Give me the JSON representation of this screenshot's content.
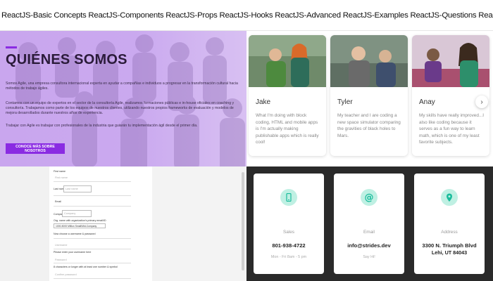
{
  "marquee": {
    "text": "ReactJS-Basic Concepts ReactJS-Components ReactJS-Props ReactJS-Hooks ReactJS-Advanced ReactJS-Examples ReactJS-Questions ReactJS-Quiz ReactJS-Tutorial Web Development Web Techno"
  },
  "about": {
    "title": "QUIÉNES SOMOS",
    "p1": "Somos Agile, una empresa consultora internacional experta en ayudar a compañías e individuos a progresar en la transformación cultural hacia métodos de trabajo ágiles.",
    "p2": "Contamos con un equipo de expertos en el sector de la consultoría Agile, realizamos formaciones públicas e in-house oficiales en coaching y consultoría. Trabajamos como parte de los equipos de nuestros clientes, utilizando nuestros propios frameworks de evaluación y modelos de mejora desarrollados durante nuestros años de experiencia.",
    "p3": "Trabajar con Agile es trabajar con profesionales de la industria que guiarán tu implementación ágil desde el primer día.",
    "cta": "CONOCE MÁS SOBRE NOSOTROS",
    "accent_color": "#8a2be2"
  },
  "testimonials": [
    {
      "name": "Jake",
      "quote": "What I'm doing with block coding, HTML and mobile apps is I'm actually making publishable apps which is really cool!"
    },
    {
      "name": "Tyler",
      "quote": "My teacher and I are coding a new space simulator comparing the gravities of black holes to Mars."
    },
    {
      "name": "Anay",
      "quote": "My skills have really improved...I also like coding because it serves as a fun way to learn math, which is one of my least favorite subjects."
    }
  ],
  "carousel_next": "›",
  "form": {
    "first_name_label": "First name",
    "first_name_ph": "First name",
    "last_name_label": "Last name",
    "last_name_ph": "Last name",
    "email_label": "Email",
    "company_label": "Company",
    "company_ph": "Company",
    "org_label": "Org. name with organization's primary email/ID",
    "org_select": "1000-5000 Million Small/Mid-Company",
    "pwd_title": "Now choose a username & password",
    "username_ph": "Username",
    "username_note": "Please enter your username here",
    "password_ph": "Password",
    "password_note": "8 characters or longer with at least one number & symbol",
    "confirm_ph": "Confirm password"
  },
  "contacts": [
    {
      "label": "Sales",
      "value": "801-938-4722",
      "sub": "Mon - Fri 8am - 5 pm",
      "icon": "phone-icon"
    },
    {
      "label": "Email",
      "value": "info@strides.dev",
      "sub": "Say Hi!",
      "icon": "at-icon"
    },
    {
      "label": "Address",
      "value": "3300 N. Triumph Blvd",
      "value2": "Lehi, UT 84043",
      "icon": "map-pin-icon"
    }
  ],
  "colors": {
    "purple": "#8a2be2",
    "mint": "#bff0e3",
    "teal": "#1abc9c",
    "dark": "#2a2a2a"
  }
}
